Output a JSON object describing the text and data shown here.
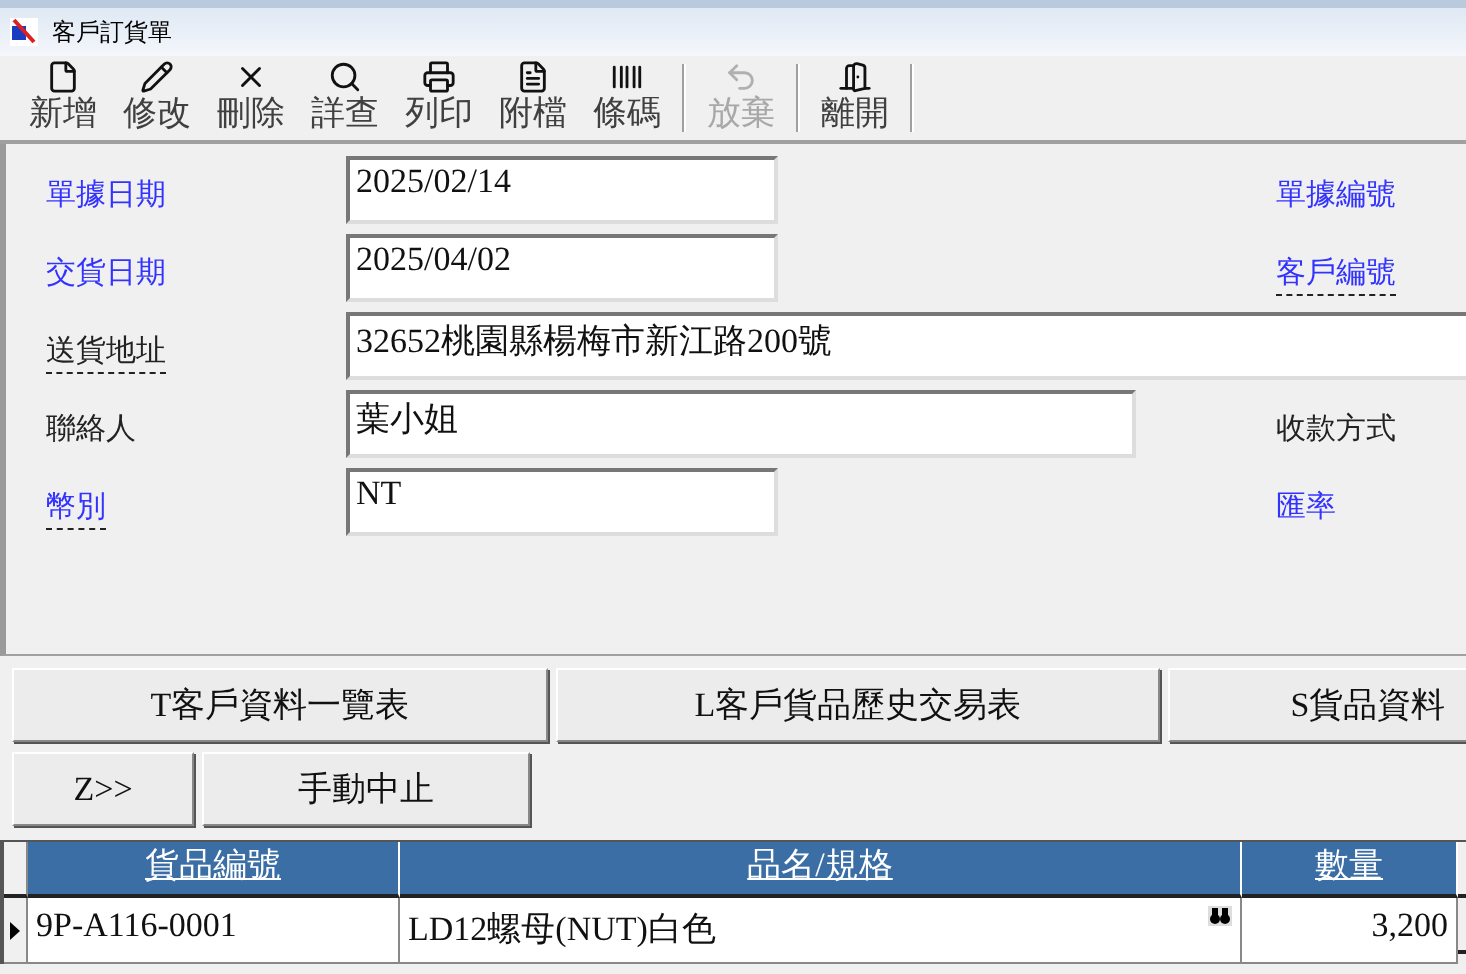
{
  "window": {
    "title": "客戶訂貨單"
  },
  "toolbar": [
    {
      "label": "新增",
      "disabled": false
    },
    {
      "label": "修改",
      "disabled": false
    },
    {
      "label": "刪除",
      "disabled": false
    },
    {
      "label": "詳查",
      "disabled": false
    },
    {
      "label": "列印",
      "disabled": false
    },
    {
      "label": "附檔",
      "disabled": false
    },
    {
      "label": "條碼",
      "disabled": false
    },
    {
      "label": "放棄",
      "disabled": true
    },
    {
      "label": "離開",
      "disabled": false
    }
  ],
  "form": {
    "rows": [
      {
        "label": {
          "text": "單據日期",
          "color": "#3333ff",
          "underlined": false
        },
        "value": "2025/02/14",
        "right_label": {
          "text": "單據編號",
          "color": "#3333ff",
          "underlined": false
        }
      },
      {
        "label": {
          "text": "交貨日期",
          "color": "#3333ff",
          "underlined": false
        },
        "value": "2025/04/02",
        "right_label": {
          "text": "客戶編號",
          "color": "#3333ff",
          "underlined": true
        }
      },
      {
        "label": {
          "text": "送貨地址",
          "color": "#222222",
          "underlined": true
        },
        "value": "32652桃園縣楊梅市新江路200號"
      },
      {
        "label": {
          "text": "聯絡人",
          "color": "#222222",
          "underlined": false
        },
        "value": "葉小姐",
        "right_label": {
          "text": "收款方式",
          "color": "#222222",
          "underlined": false
        }
      },
      {
        "label": {
          "text": "幣別",
          "color": "#3333ff",
          "underlined": true
        },
        "value": "NT",
        "right_label": {
          "text": "匯率",
          "color": "#3333ff",
          "underlined": false
        }
      }
    ]
  },
  "buttons_row1": [
    "T客戶資料一覽表",
    "L客戶貨品歷史交易表",
    "S貨品資料"
  ],
  "buttons_row2": [
    "Z>>",
    "手動中止"
  ],
  "table": {
    "columns": [
      "貨品編號",
      "品名/規格",
      "數量"
    ],
    "rows": [
      {
        "selected": true,
        "cells": [
          "9P-A116-0001",
          "LD12螺母(NUT)白色",
          "3,200"
        ]
      }
    ]
  }
}
